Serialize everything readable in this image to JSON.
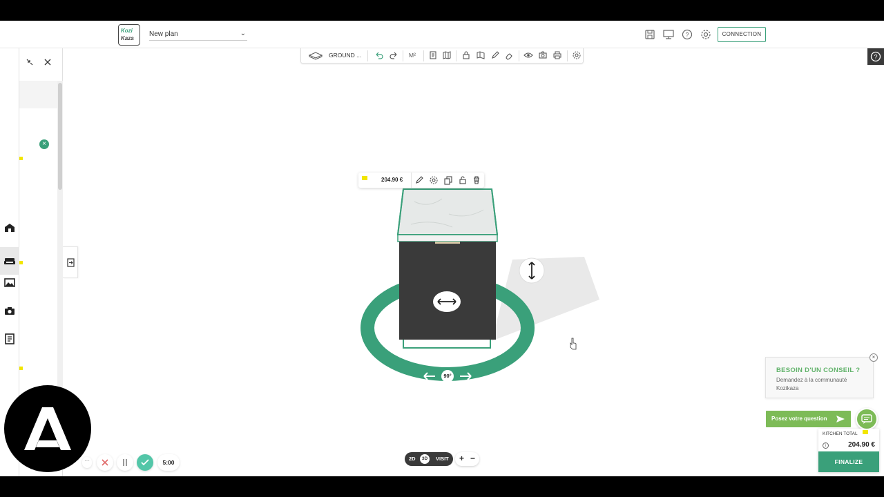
{
  "header": {
    "logo_top": "Kozi",
    "logo_bottom": "Kaza",
    "plan_name": "New plan",
    "connection_label": "CONNECTION",
    "icons": [
      "save-icon",
      "monitor-icon",
      "help-icon",
      "settings-icon"
    ]
  },
  "toolbar": {
    "level_label": "GROUND ...",
    "units_label": "M²"
  },
  "object_toolbar": {
    "price": "204.90 €",
    "brand_text": "IKEA"
  },
  "scene": {
    "rotation_label": "90°",
    "accent_color": "#3aa07a",
    "cabinet_color": "#3a3a3a"
  },
  "view_switch": {
    "mode_2d": "2D",
    "mode_3d": "3D",
    "mode_visit": "VISIT",
    "zoom_in": "+",
    "zoom_out": "−"
  },
  "recorder": {
    "more": "···",
    "timer": "5:00"
  },
  "advice": {
    "title": "BESOIN D'UN CONSEIL ?",
    "body": "Demandez à la communauté Kozikaza",
    "close": "×",
    "ask_button": "Posez votre question"
  },
  "total": {
    "label": "KITCHEN TOTAL",
    "price": "204.90 €",
    "info": "i",
    "finalize": "FINALIZE",
    "brand_text": "IKEA"
  }
}
